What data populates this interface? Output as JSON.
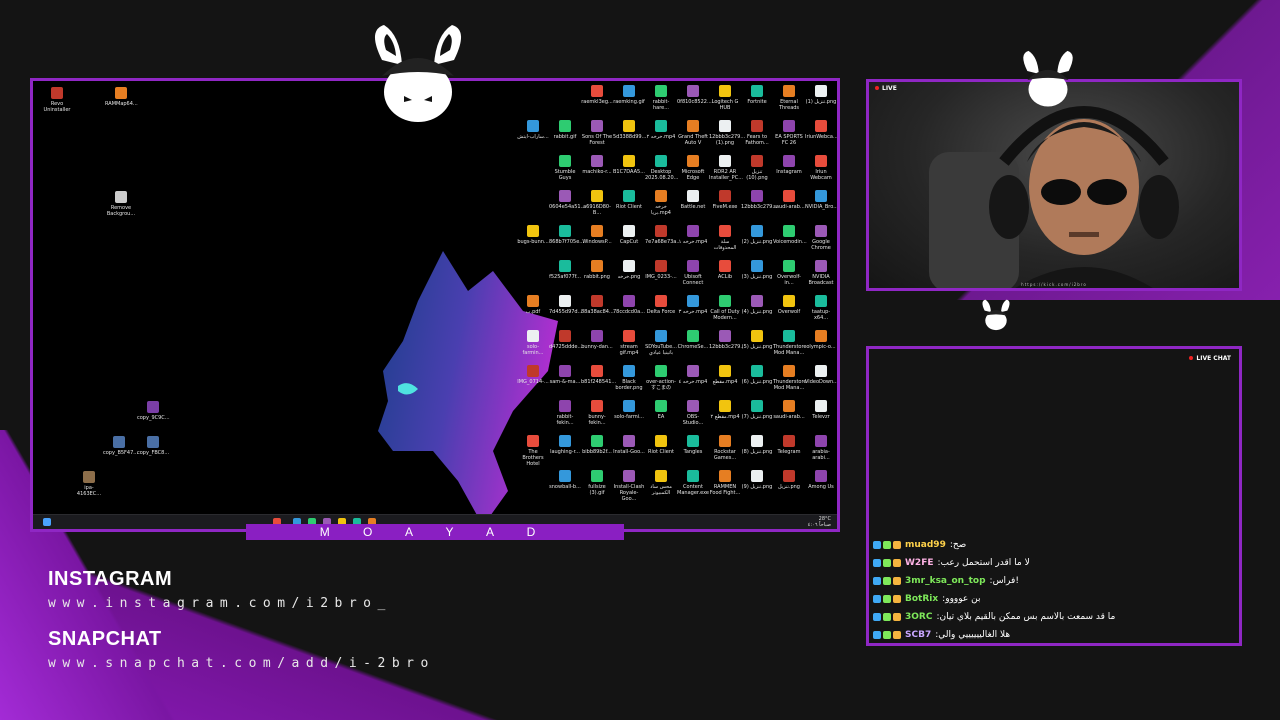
{
  "overlay": {
    "name_bar": "M O A Y A D",
    "social": [
      {
        "title": "INSTAGRAM",
        "url": "www.instagram.com/i2bro_"
      },
      {
        "title": "SNAPCHAT",
        "url": "www.snapchat.com/add/i-2bro"
      }
    ]
  },
  "webcam": {
    "live_label": "LIVE",
    "url_text": "https://kick.com/i2bro"
  },
  "chat": {
    "title": "LIVE CHAT",
    "messages": [
      {
        "user": "muad99",
        "color": "#ffd24a",
        "text": "صح"
      },
      {
        "user": "W2FE",
        "color": "#ffb3e6",
        "text": "لا ما اقدر استحمل رعب"
      },
      {
        "user": "3mr_ksa_on_top",
        "color": "#7ee85a",
        "text": "فراس!"
      },
      {
        "user": "BotRix",
        "color": "#7ee85a",
        "text": "بن عوووو"
      },
      {
        "user": "3ORC",
        "color": "#7ee85a",
        "text": "ما قد سمعت بالاسم بس ممكن بالقيم بلاي تيان"
      },
      {
        "user": "SCB7",
        "color": "#c9a6ff",
        "text": "هلا الغالييييييي والي"
      }
    ]
  },
  "desktop": {
    "left_icons": [
      {
        "label": "Revo Uninstaller",
        "color": "#c0392b"
      },
      {
        "label": "RAMMap64...",
        "color": "#e67e22"
      },
      {
        "label": "Remove Backgrou...",
        "color": "#cccccc"
      },
      {
        "label": "copy_9C9C...",
        "color": "#7a3ea6"
      },
      {
        "label": "copy_B5F47...",
        "color": "#4a6fa5"
      },
      {
        "label": "copy_FBC8...",
        "color": "#4a6fa5"
      },
      {
        "label": "ipa-4163EC...",
        "color": "#8d6e4a"
      }
    ],
    "grid_icons": [
      [
        "raemkl3eg...",
        "raemking.gif",
        "rabbit-hare...",
        "0f810c8522...",
        "Logitech G HUB",
        "Fortnite",
        "Eternal Threads",
        "تنزيل (1).png"
      ],
      [
        "ساراب-ایتش...",
        "rabbit.gif",
        "Sons Of The Forest",
        "5d3388d99...",
        "خرخه ٢.mp4",
        "Grand Theft Auto V",
        "12bbb3c279... (1).png",
        "Fears to Fathom...",
        "EA SPORTS FC 26",
        "IriunWebca..."
      ],
      [
        "Stumble Guys",
        "machiko-r...",
        "B1C7DAA5...",
        "Desktop 2025.08.20...",
        "Microsoft Edge",
        "RDR2 AR Installer_PC...",
        "تنزيل (10).png",
        "Instagram",
        "Iriun Webcam"
      ],
      [
        "0604e54a51...",
        "a6916D80-B...",
        "Riot Client",
        "خرخه بريا.mp4",
        "Battle.net",
        "FiveM.exe",
        "12bbb3c279...",
        "saudi-arab...",
        "NVIDIA_Bro..."
      ],
      [
        "bugs-bunn...",
        "868b7f705e...",
        "WindowsP...",
        "CapCut",
        "7e7a68e73a...",
        "خرخه ١.mp4",
        "سلة المحذوفات",
        "تنزيل (2).png",
        "Voicemodin...",
        "Google Chrome"
      ],
      [
        "f525af077f...",
        "rabbit.png",
        "خرخه.png",
        "IMG_0233-...",
        "Ubisoft Connect",
        "ACLib",
        "تنزيل (3).png",
        "Overwolf-in...",
        "NVIDIA Broadcast"
      ],
      [
        "ب.pdf",
        "7d455d97d...",
        "88a38ac84...",
        "78ccdcd0a...",
        "Delta Force",
        "خرخه ٣.mp4",
        "Call of Duty Modern...",
        "تنزيل (4).png",
        "Overwolf",
        "taatup-x64..."
      ],
      [
        "solo-farmin...",
        "d4725ddde...",
        "bunny-dan...",
        "stream gif.mp4",
        "SDYouTube... باتينيا عيادي",
        "ChromeSe...",
        "12bbb3c279...",
        "تنزيل (5).png",
        "Thunderstore Mod Mana...",
        "olympic-o..."
      ],
      [
        "IMG_0714-...",
        "sam-&-ma...",
        "b81f248541...",
        "Black border.png",
        "over-action-すこまの",
        "خرخه ٤.mp4",
        "مقطع.mp4",
        "تنزيل (6).png",
        "Thunderstore Mod Mana...",
        "VideoDown..."
      ],
      [
        "rabbit-fekin...",
        "bunny-fekin...",
        "solo-farmi...",
        "EA",
        "OBS-Studio...",
        "مقطع ٢.mp4",
        "تنزيل (7).png",
        "saudi-arab...",
        "Televzr"
      ],
      [
        "The Brothers Hotel",
        "laughing-r...",
        "bibb89b2f...",
        "Install-Goo...",
        "Riot Client",
        "Tangles",
        "Rockstar Games...",
        "تنزيل (8).png",
        "Telegram",
        "arabia-arabi..."
      ],
      [
        "snowball-b...",
        "fullsize (3).gif",
        "Install-Clash Royale-Goo...",
        "محس ساد الكمبيوتر",
        "Content Manager.exe",
        "RAMMEN Food Fight...",
        "تنزيل (9).png",
        "تنزيل.png",
        "Among Us"
      ]
    ],
    "tray_time": "صباحاً ٤:٠٦",
    "tray_weather": "28°C"
  },
  "colors": {
    "accent": "#8f27c4",
    "background": "#141414"
  }
}
